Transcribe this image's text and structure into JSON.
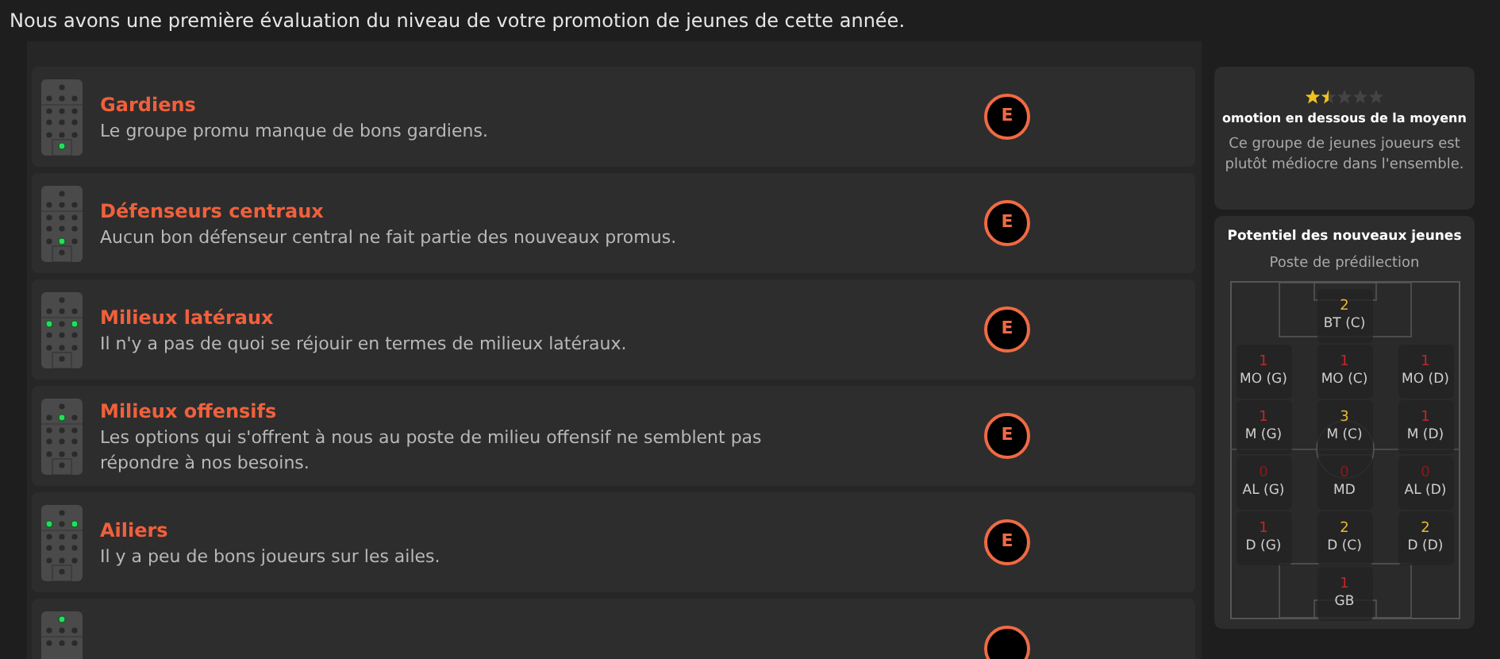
{
  "intro": "Nous avons une première évaluation du niveau de votre promotion de jeunes de cette année.",
  "groups": [
    {
      "title": "Gardiens",
      "description": "Le groupe promu manque de bons gardiens.",
      "grade": "E",
      "dots": [
        [
          false
        ],
        [
          false,
          false,
          false
        ],
        [
          false,
          false,
          false
        ],
        [
          false,
          false,
          false
        ],
        [
          false,
          false,
          false
        ],
        [
          true
        ]
      ]
    },
    {
      "title": "Défenseurs centraux",
      "description": "Aucun bon défenseur central ne fait partie des nouveaux promus.",
      "grade": "E",
      "dots": [
        [
          false
        ],
        [
          false,
          false,
          false
        ],
        [
          false,
          false,
          false
        ],
        [
          false,
          false,
          false
        ],
        [
          false,
          true,
          false
        ],
        [
          false
        ]
      ]
    },
    {
      "title": "Milieux latéraux",
      "description": "Il n'y a pas de quoi se réjouir en termes de milieux latéraux.",
      "grade": "E",
      "dots": [
        [
          false
        ],
        [
          false,
          false,
          false
        ],
        [
          true,
          false,
          true
        ],
        [
          false,
          false,
          false
        ],
        [
          false,
          false,
          false
        ],
        [
          false
        ]
      ]
    },
    {
      "title": "Milieux offensifs",
      "description": "Les options qui s'offrent à nous au poste de milieu offensif ne semblent pas répondre à nos besoins.",
      "grade": "E",
      "dots": [
        [
          false
        ],
        [
          false,
          true,
          false
        ],
        [
          false,
          false,
          false
        ],
        [
          false,
          false,
          false
        ],
        [
          false,
          false,
          false
        ],
        [
          false
        ]
      ]
    },
    {
      "title": "Ailiers",
      "description": "Il y a peu de bons joueurs sur les ailes.",
      "grade": "E",
      "dots": [
        [
          false
        ],
        [
          true,
          false,
          true
        ],
        [
          false,
          false,
          false
        ],
        [
          false,
          false,
          false
        ],
        [
          false,
          false,
          false
        ],
        [
          false
        ]
      ]
    },
    {
      "dots": [
        [
          true
        ],
        [
          false,
          false,
          false
        ],
        [
          false,
          false,
          false
        ]
      ]
    }
  ],
  "rating": {
    "stars": 1.5,
    "title": "omotion en dessous de la moyenn",
    "description": "Ce groupe de jeunes joueurs est plutôt médiocre dans l'ensemble."
  },
  "potential": {
    "title": "Potentiel des nouveaux jeunes",
    "subtitle": "Poste de prédilection",
    "rows": [
      [
        null,
        {
          "count": "2",
          "label": "BT (C)",
          "color": "#e8b830"
        },
        null
      ],
      [
        {
          "count": "1",
          "label": "MO (G)",
          "color": "#c0282c"
        },
        {
          "count": "1",
          "label": "MO (C)",
          "color": "#c0282c"
        },
        {
          "count": "1",
          "label": "MO (D)",
          "color": "#c0282c"
        }
      ],
      [
        {
          "count": "1",
          "label": "M (G)",
          "color": "#c0282c"
        },
        {
          "count": "3",
          "label": "M (C)",
          "color": "#e8b830"
        },
        {
          "count": "1",
          "label": "M (D)",
          "color": "#c0282c"
        }
      ],
      [
        {
          "count": "0",
          "label": "AL (G)",
          "color": "#8c1a1c"
        },
        {
          "count": "0",
          "label": "MD",
          "color": "#8c1a1c"
        },
        {
          "count": "0",
          "label": "AL (D)",
          "color": "#8c1a1c"
        }
      ],
      [
        {
          "count": "1",
          "label": "D (G)",
          "color": "#c0282c"
        },
        {
          "count": "2",
          "label": "D (C)",
          "color": "#e8b830"
        },
        {
          "count": "2",
          "label": "D (D)",
          "color": "#e8b830"
        }
      ],
      [
        null,
        {
          "count": "1",
          "label": "GB",
          "color": "#c0282c"
        },
        null
      ]
    ]
  }
}
